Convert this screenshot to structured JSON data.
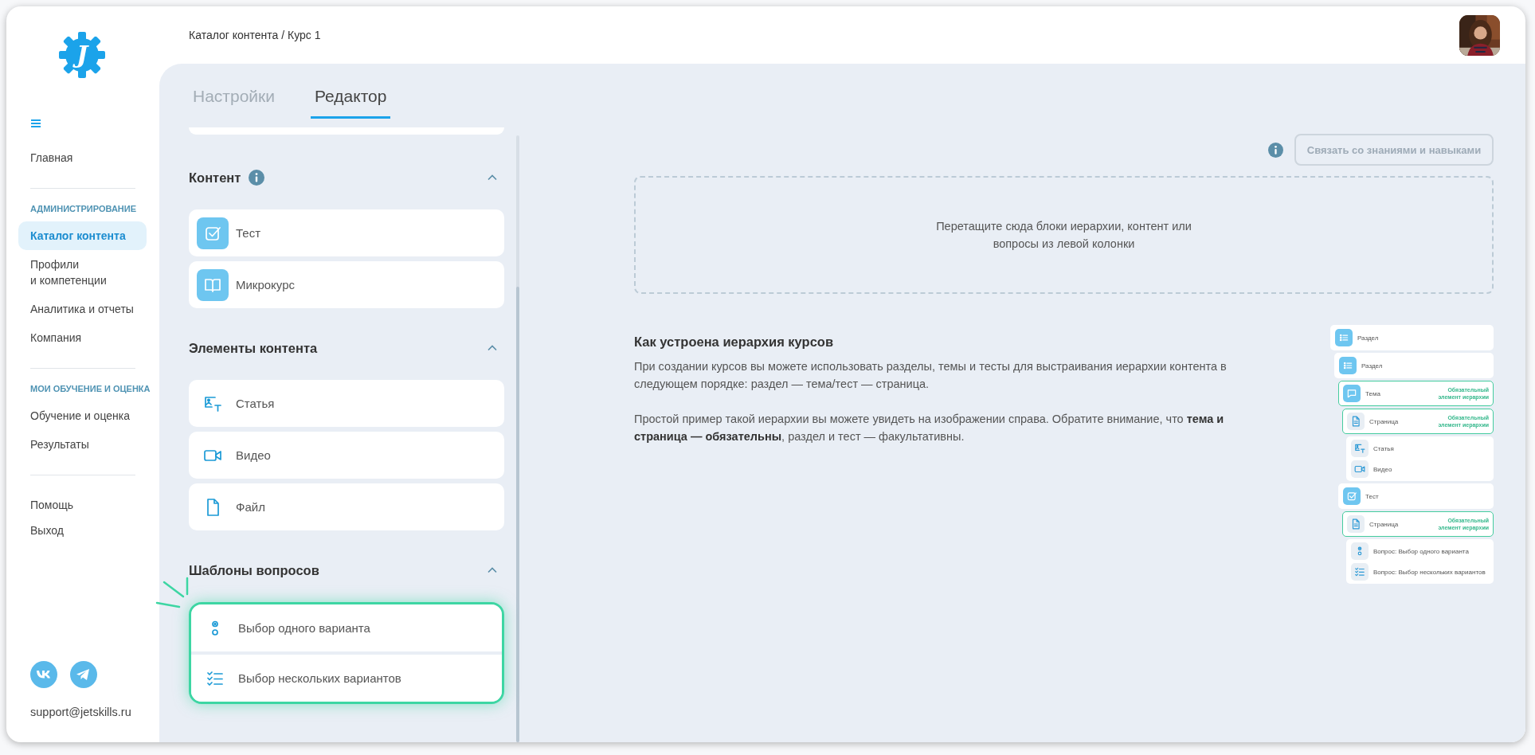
{
  "logo": {
    "letter": "J"
  },
  "sidebar": {
    "groups": [
      {
        "items": [
          {
            "label": "Главная",
            "selected": false
          }
        ]
      },
      {
        "title": "АДМИНИСТРИРОВАНИЕ",
        "items": [
          {
            "label": "Каталог контента",
            "selected": true
          },
          {
            "label": "Профили\nи компетенции",
            "selected": false
          },
          {
            "label": "Аналитика и отчеты",
            "selected": false
          },
          {
            "label": "Компания",
            "selected": false
          }
        ]
      },
      {
        "title": "МОИ ОБУЧЕНИЕ И ОЦЕНКА",
        "items": [
          {
            "label": "Обучение и оценка",
            "selected": false
          },
          {
            "label": "Результаты",
            "selected": false
          }
        ]
      },
      {
        "items": [
          {
            "label": "Помощь",
            "selected": false
          },
          {
            "label": "Выход",
            "selected": false
          }
        ]
      }
    ],
    "support_email": "support@jetskills.ru"
  },
  "breadcrumb": "Каталог контента / Курс 1",
  "tabs": [
    {
      "label": "Настройки",
      "selected": false
    },
    {
      "label": "Редактор",
      "selected": true
    }
  ],
  "palette": {
    "sections": [
      {
        "title": "Контент",
        "info": true,
        "expanded": true,
        "highlighted": false,
        "items": [
          {
            "kind": "test",
            "label": "Тест"
          },
          {
            "kind": "microcourse",
            "label": "Микрокурс"
          }
        ]
      },
      {
        "title": "Элементы контента",
        "info": false,
        "expanded": true,
        "highlighted": false,
        "items": [
          {
            "kind": "article",
            "label": "Статья"
          },
          {
            "kind": "video",
            "label": "Видео"
          },
          {
            "kind": "file",
            "label": "Файл"
          }
        ]
      },
      {
        "title": "Шаблоны вопросов",
        "info": false,
        "expanded": true,
        "highlighted": true,
        "items": [
          {
            "kind": "single_choice",
            "label": "Выбор одного варианта"
          },
          {
            "kind": "multiple_choice",
            "label": "Выбор нескольких вариантов"
          }
        ]
      }
    ]
  },
  "editor": {
    "link_button": {
      "label": "Связать со знаниями и навыками",
      "disabled": true
    },
    "dropzone": "Перетащите сюда блоки иерархии, контент или\nвопросы из левой колонки",
    "help": {
      "title": "Как устроена иерархия курсов",
      "paragraphs": [
        "При создании курсов вы можете использовать разделы, темы и тесты для выстраивания иерархии контента в следующем порядке: раздел — тема/тест — страница.",
        "Простой пример такой иерархии вы можете увидеть на изображении справа. Обратите внимание, что **тема и страница — обязательны**, раздел и тест — факультативны."
      ]
    },
    "hierarchy_example": {
      "items": [
        {
          "kind": "section",
          "label": "Раздел",
          "required": false,
          "children": [
            {
              "kind": "section",
              "label": "Раздел",
              "required": false,
              "children": [
                {
                  "kind": "topic",
                  "label": "Тема",
                  "required": true,
                  "note": "Обязательный\nэлемент иерархии",
                  "children": [
                    {
                      "kind": "page",
                      "label": "Страница",
                      "required": true,
                      "note": "Обязательный\nэлемент иерархии",
                      "children": [
                        {
                          "kind": "article",
                          "label": "Статья"
                        },
                        {
                          "kind": "video",
                          "label": "Видео"
                        }
                      ]
                    }
                  ]
                },
                {
                  "kind": "test",
                  "label": "Тест",
                  "required": false,
                  "children": [
                    {
                      "kind": "page",
                      "label": "Страница",
                      "required": true,
                      "note": "Обязательный\nэлемент иерархии",
                      "children": [
                        {
                          "kind": "single_choice",
                          "label": "Вопрос: Выбор одного варианта"
                        },
                        {
                          "kind": "multiple_choice",
                          "label": "Вопрос: Выбор нескольких вариантов"
                        }
                      ]
                    }
                  ]
                }
              ]
            }
          ]
        }
      ]
    }
  }
}
